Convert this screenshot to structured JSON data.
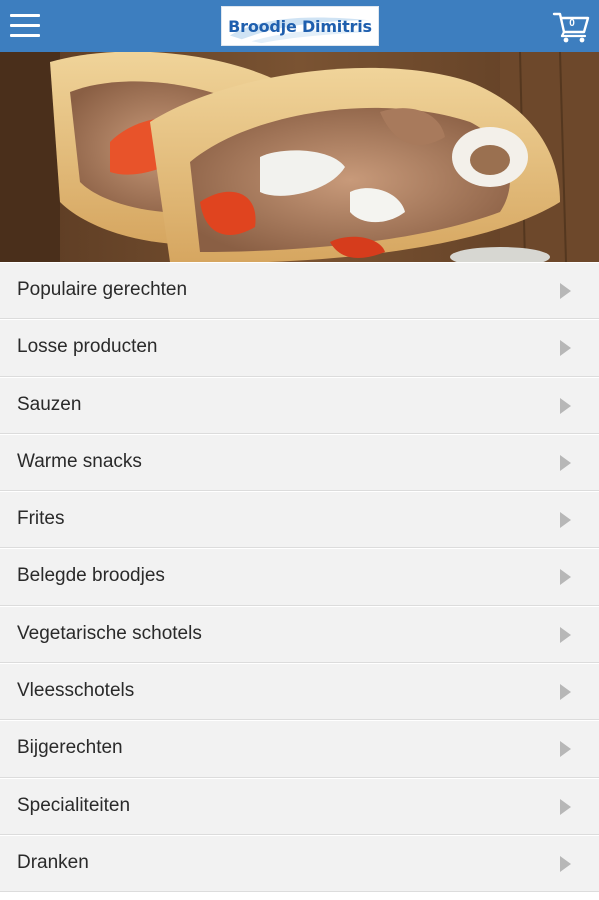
{
  "header": {
    "logo_text": "Broodje Dimitris",
    "cart_count": "0",
    "colors": {
      "bar": "#3d7ebf",
      "logo_text": "#1f5fae"
    }
  },
  "hero": {
    "alt": "Gyros pita broodjes"
  },
  "menu": {
    "items": [
      {
        "label": "Populaire gerechten"
      },
      {
        "label": "Losse producten"
      },
      {
        "label": "Sauzen"
      },
      {
        "label": "Warme snacks"
      },
      {
        "label": "Frites"
      },
      {
        "label": "Belegde broodjes"
      },
      {
        "label": "Vegetarische schotels"
      },
      {
        "label": "Vleesschotels"
      },
      {
        "label": "Bijgerechten"
      },
      {
        "label": "Specialiteiten"
      },
      {
        "label": "Dranken"
      }
    ]
  }
}
